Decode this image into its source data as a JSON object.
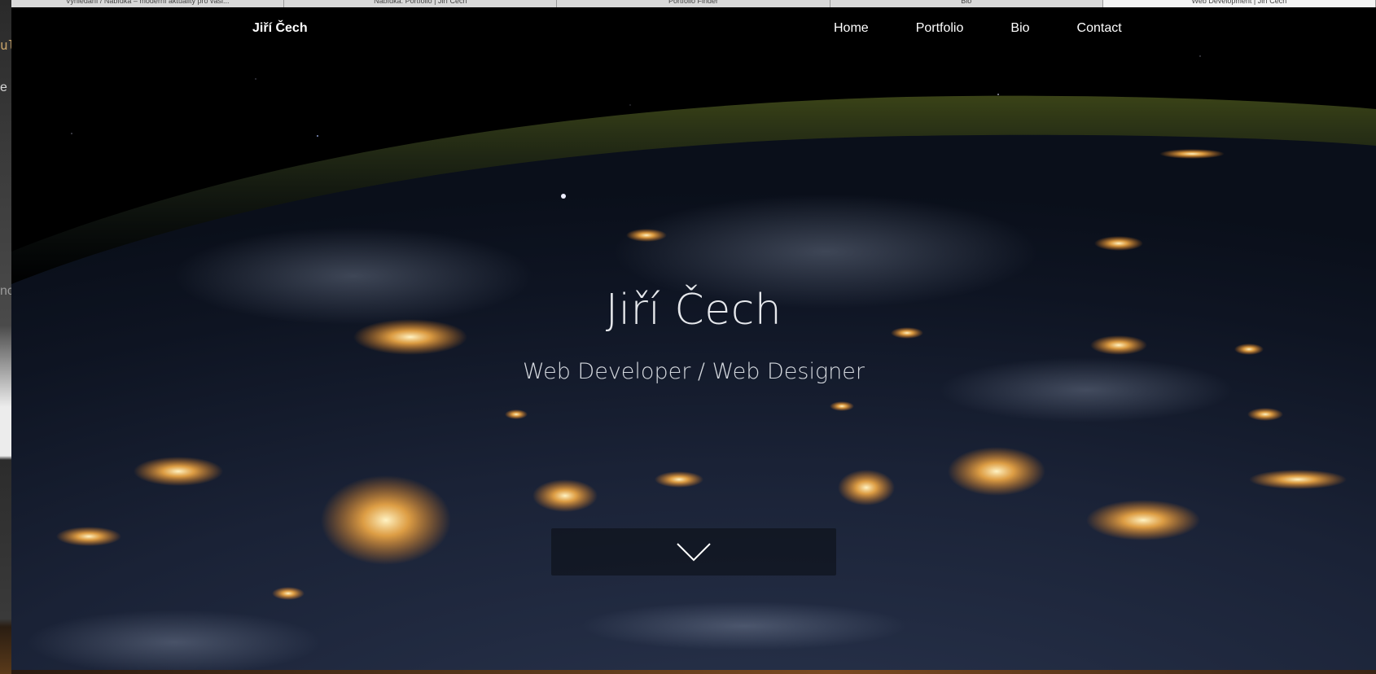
{
  "browser": {
    "tabs": [
      {
        "label": "Vyhledání / Nabídka – moderní aktuality pro vaši...",
        "active": false
      },
      {
        "label": "Nabídka: Portfolio | Jiří Čech",
        "active": false
      },
      {
        "label": "Portfolio Finder",
        "active": false
      },
      {
        "label": "Bio",
        "active": false
      },
      {
        "label": "Web Development | Jiří Čech",
        "active": true
      }
    ]
  },
  "background_window": {
    "fragments": [
      "ul",
      "e",
      "nc"
    ]
  },
  "navbar": {
    "brand": "Jiří Čech",
    "links": [
      "Home",
      "Portfolio",
      "Bio",
      "Contact"
    ]
  },
  "hero": {
    "title": "Jiří Čech",
    "subtitle": "Web Developer / Web Designer",
    "scroll_icon": "chevron-down-icon"
  },
  "colors": {
    "space": "#000000",
    "city_lights": "#ffb347",
    "nav_text": "#ffffff"
  }
}
